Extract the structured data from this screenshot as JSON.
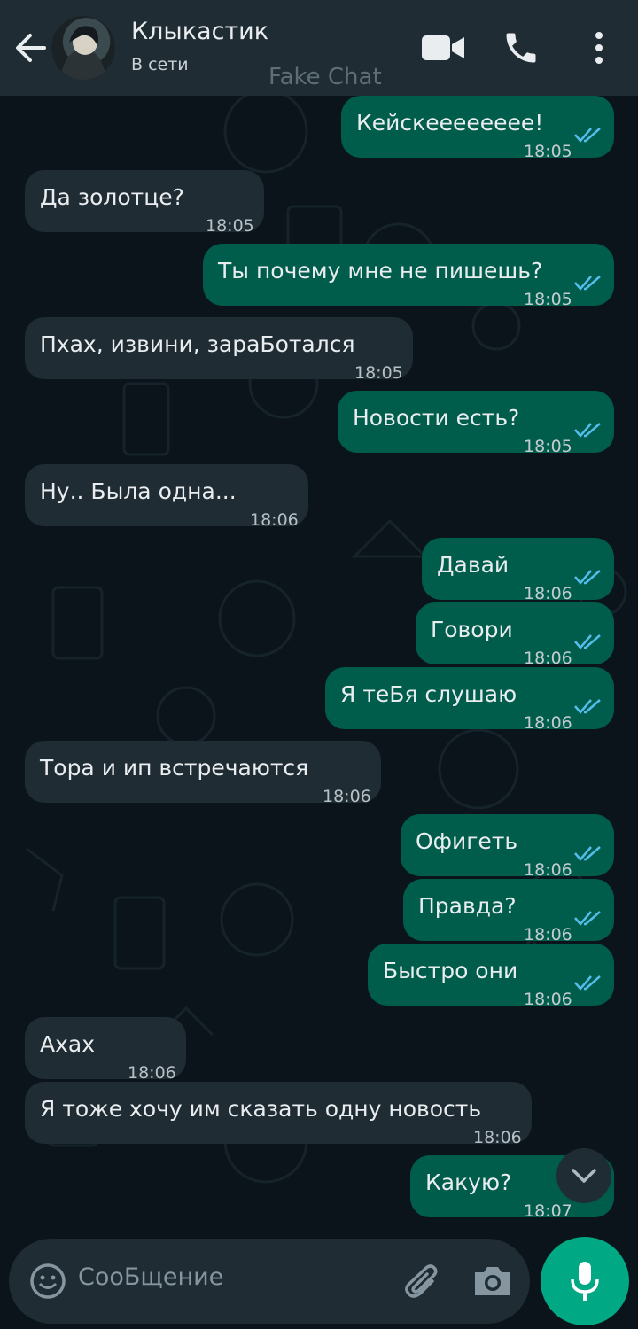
{
  "header": {
    "contact_name": "Клыкастик",
    "status": "В сети",
    "watermark": "Fake Chat",
    "icons": [
      "back-arrow-icon",
      "video-call-icon",
      "phone-icon",
      "more-vert-icon"
    ]
  },
  "colors": {
    "background": "#0b141a",
    "header": "#1f2c34",
    "incoming_bubble": "#1f2c34",
    "outgoing_bubble": "#005c4b",
    "read_ticks": "#53bdeb",
    "accent": "#00a884"
  },
  "messages": [
    {
      "direction": "out",
      "text": "Кейскееееееее!",
      "time": "18:05",
      "status": "read"
    },
    {
      "direction": "in",
      "text": "Да золотце?",
      "time": "18:05"
    },
    {
      "direction": "out",
      "text": "Ты почему мне не пишешь?",
      "time": "18:05",
      "status": "read"
    },
    {
      "direction": "in",
      "text": "Пхах, извини, зараБотался",
      "time": "18:05"
    },
    {
      "direction": "out",
      "text": "Новости есть?",
      "time": "18:05",
      "status": "read"
    },
    {
      "direction": "in",
      "text": "Ну.. Была одна...",
      "time": "18:06"
    },
    {
      "direction": "out",
      "text": "Давай",
      "time": "18:06",
      "status": "read"
    },
    {
      "direction": "out",
      "text": "Говори",
      "time": "18:06",
      "status": "read"
    },
    {
      "direction": "out",
      "text": "Я теБя слушаю",
      "time": "18:06",
      "status": "read"
    },
    {
      "direction": "in",
      "text": "Тора и ип встречаются",
      "time": "18:06"
    },
    {
      "direction": "out",
      "text": "Офигеть",
      "time": "18:06",
      "status": "read"
    },
    {
      "direction": "out",
      "text": "Правда?",
      "time": "18:06",
      "status": "read"
    },
    {
      "direction": "out",
      "text": "Быстро они",
      "time": "18:06",
      "status": "read"
    },
    {
      "direction": "in",
      "text": "Ахах",
      "time": "18:06"
    },
    {
      "direction": "in",
      "text": "Я тоже хочу им сказать одну новость",
      "time": "18:06"
    },
    {
      "direction": "out",
      "text": "Какую?",
      "time": "18:07",
      "status": "read"
    }
  ],
  "composer": {
    "placeholder": "СооБщение",
    "icons": [
      "emoji-icon",
      "attach-icon",
      "camera-icon",
      "mic-icon"
    ]
  },
  "scroll_button": {
    "icon": "chevron-down-icon"
  }
}
